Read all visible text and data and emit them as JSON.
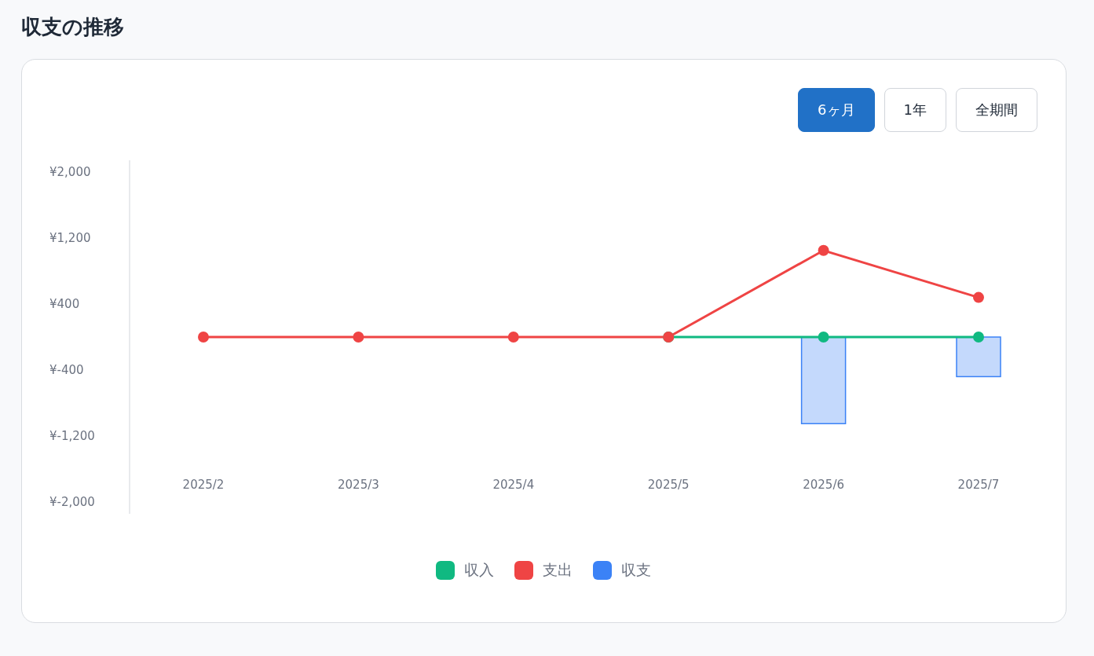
{
  "page_title": "収支の推移",
  "period_buttons": [
    {
      "label": "6ヶ月",
      "selected": true
    },
    {
      "label": "1年",
      "selected": false
    },
    {
      "label": "全期間",
      "selected": false
    }
  ],
  "chart_data": {
    "type": "line",
    "categories": [
      "2025/2",
      "2025/3",
      "2025/4",
      "2025/5",
      "2025/6",
      "2025/7"
    ],
    "ylim": [
      -2000,
      2000
    ],
    "yticks": [
      {
        "value": 2000,
        "label": "¥2,000"
      },
      {
        "value": 1200,
        "label": "¥1,200"
      },
      {
        "value": 400,
        "label": "¥400"
      },
      {
        "value": -400,
        "label": "¥-400"
      },
      {
        "value": -1200,
        "label": "¥-1,200"
      },
      {
        "value": -2000,
        "label": "¥-2,000"
      }
    ],
    "series": [
      {
        "name": "収入",
        "marker": "circle",
        "color": "#10b981",
        "values": [
          null,
          null,
          null,
          0,
          0,
          0
        ]
      },
      {
        "name": "支出",
        "marker": "circle",
        "color": "#ef4444",
        "values": [
          0,
          0,
          0,
          0,
          1050,
          480
        ]
      },
      {
        "name": "収支",
        "type": "bar",
        "color": "#3b82f6",
        "values": [
          0,
          0,
          0,
          0,
          -1050,
          -480
        ]
      }
    ]
  }
}
